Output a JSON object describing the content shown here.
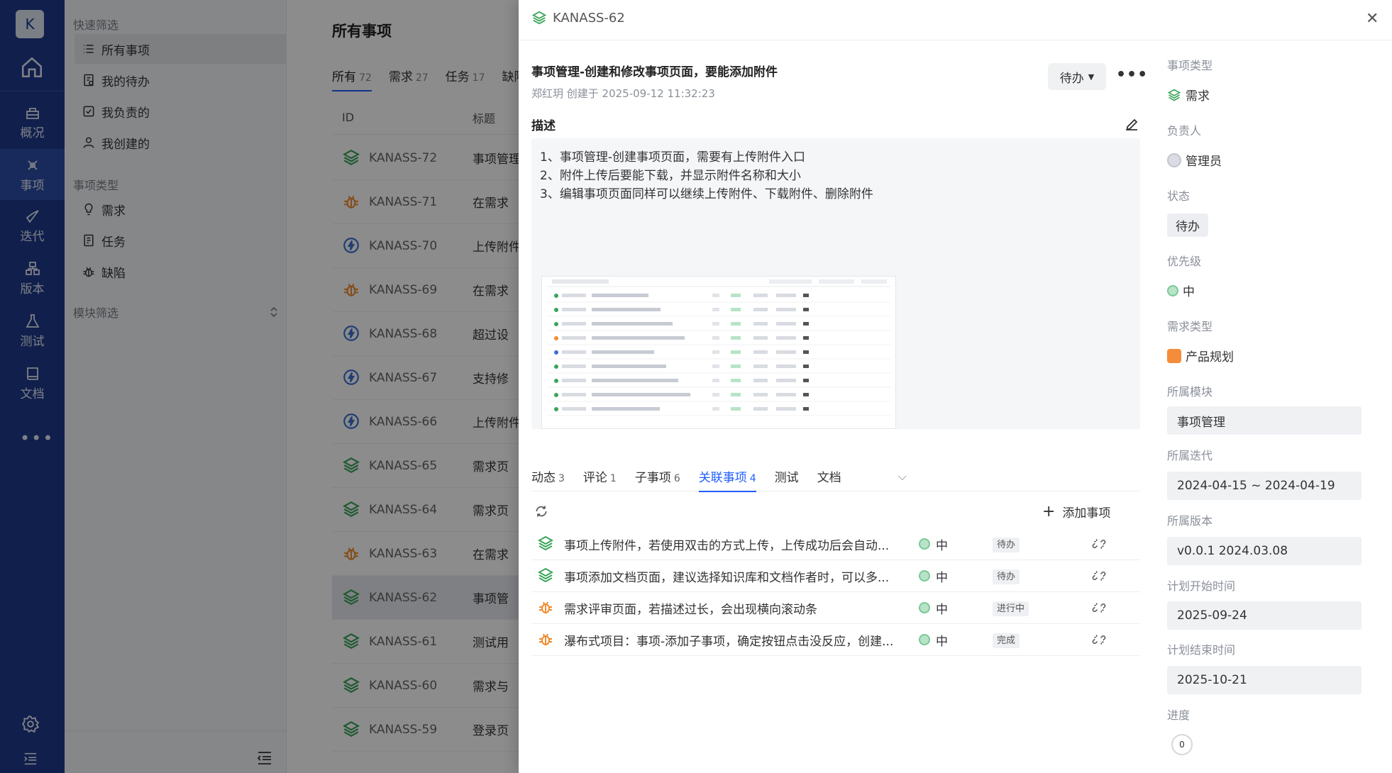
{
  "rail": {
    "logo": "K",
    "items": [
      {
        "label": "概况"
      },
      {
        "label": "事项"
      },
      {
        "label": "迭代"
      },
      {
        "label": "版本"
      },
      {
        "label": "测试"
      },
      {
        "label": "文档"
      }
    ],
    "more": "•••"
  },
  "filter": {
    "quick_title": "快速筛选",
    "quick_items": [
      {
        "label": "所有事项"
      },
      {
        "label": "我的待办"
      },
      {
        "label": "我负责的"
      },
      {
        "label": "我创建的"
      }
    ],
    "type_title": "事项类型",
    "type_items": [
      {
        "label": "需求"
      },
      {
        "label": "任务"
      },
      {
        "label": "缺陷"
      }
    ],
    "module_title": "模块筛选"
  },
  "list": {
    "title": "所有事项",
    "tabs": [
      {
        "label": "所有",
        "count": "72"
      },
      {
        "label": "需求",
        "count": "27"
      },
      {
        "label": "任务",
        "count": "17"
      },
      {
        "label": "缺陷",
        "count": ""
      }
    ],
    "col_id": "ID",
    "col_title": "标题",
    "rows": [
      {
        "id": "KANASS-72",
        "title": "事项管理",
        "type": "req"
      },
      {
        "id": "KANASS-71",
        "title": "在需求",
        "type": "bug"
      },
      {
        "id": "KANASS-70",
        "title": "上传附件",
        "type": "task"
      },
      {
        "id": "KANASS-69",
        "title": "在需求",
        "type": "bug"
      },
      {
        "id": "KANASS-68",
        "title": "超过设",
        "type": "task"
      },
      {
        "id": "KANASS-67",
        "title": "支持修",
        "type": "task"
      },
      {
        "id": "KANASS-66",
        "title": "上传附件",
        "type": "task"
      },
      {
        "id": "KANASS-65",
        "title": "需求页",
        "type": "req"
      },
      {
        "id": "KANASS-64",
        "title": "需求页",
        "type": "req"
      },
      {
        "id": "KANASS-63",
        "title": "在需求",
        "type": "bug"
      },
      {
        "id": "KANASS-62",
        "title": "事项管",
        "type": "req"
      },
      {
        "id": "KANASS-61",
        "title": "测试用",
        "type": "req"
      },
      {
        "id": "KANASS-60",
        "title": "需求与",
        "type": "req"
      },
      {
        "id": "KANASS-59",
        "title": "登录页",
        "type": "req"
      }
    ]
  },
  "detail": {
    "key": "KANASS-62",
    "title": "事项管理-创建和修改事项页面，要能添加附件",
    "meta": "郑红玥 创建于 2025-09-12 11:32:23",
    "status": "待办",
    "desc_label": "描述",
    "desc_lines": [
      "1、事项管理-创建事项页面，需要有上传附件入口",
      "2、附件上传后要能下载，并显示附件名称和大小",
      "3、编辑事项页面同样可以继续上传附件、下载附件、删除附件"
    ],
    "subtabs": [
      {
        "label": "动态",
        "count": "3"
      },
      {
        "label": "评论",
        "count": "1"
      },
      {
        "label": "子事项",
        "count": "6"
      },
      {
        "label": "关联事项",
        "count": "4"
      },
      {
        "label": "测试",
        "count": ""
      },
      {
        "label": "文档",
        "count": ""
      }
    ],
    "add_label": "添加事项",
    "related": [
      {
        "title": "事项上传附件，若使用双击的方式上传，上传成功后会自动...",
        "priority": "中",
        "status": "待办",
        "type": "req"
      },
      {
        "title": "事项添加文档页面，建议选择知识库和文档作者时，可以多...",
        "priority": "中",
        "status": "待办",
        "type": "req"
      },
      {
        "title": "需求评审页面，若描述过长，会出现横向滚动条",
        "priority": "中",
        "status": "进行中",
        "type": "bug"
      },
      {
        "title": "瀑布式项目：事项-添加子事项，确定按钮点击没反应，创建...",
        "priority": "中",
        "status": "完成",
        "type": "bug"
      }
    ]
  },
  "props": {
    "type_label": "事项类型",
    "type_value": "需求",
    "owner_label": "负责人",
    "owner_value": "管理员",
    "status_label": "状态",
    "status_value": "待办",
    "priority_label": "优先级",
    "priority_value": "中",
    "reqtype_label": "需求类型",
    "reqtype_value": "产品规划",
    "module_label": "所属模块",
    "module_value": "事项管理",
    "sprint_label": "所属迭代",
    "sprint_value": "2024-04-15 ~ 2024-04-19",
    "version_label": "所属版本",
    "version_value": "v0.0.1 2024.03.08",
    "start_label": "计划开始时间",
    "start_value": "2025-09-24",
    "end_label": "计划结束时间",
    "end_value": "2025-10-21",
    "progress_label": "进度",
    "progress_value": "0"
  }
}
